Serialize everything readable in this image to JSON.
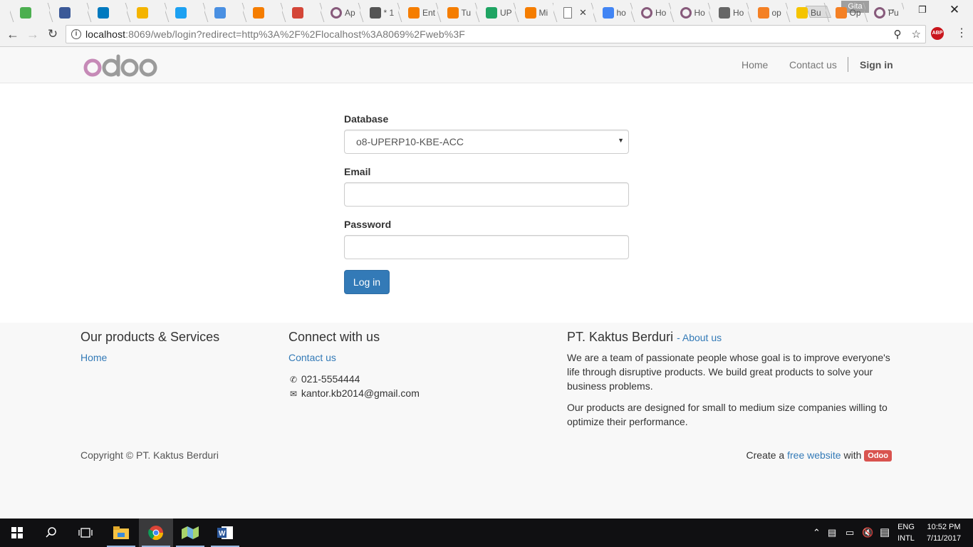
{
  "browser": {
    "tabs": [
      {
        "label": "",
        "color": "#4caf50"
      },
      {
        "label": "",
        "color": "#3b5998"
      },
      {
        "label": "",
        "color": "#0079bf"
      },
      {
        "label": "",
        "color": "#f4b400"
      },
      {
        "label": "",
        "color": "#1da1f2"
      },
      {
        "label": "",
        "color": "#4a90e2"
      },
      {
        "label": "",
        "color": "#f57d00"
      },
      {
        "label": "",
        "color": "#d44638"
      },
      {
        "label": "Ap",
        "color": "ring"
      },
      {
        "label": "* 1",
        "color": "#555555"
      },
      {
        "label": "Ent",
        "color": "#f57d00"
      },
      {
        "label": "Tu",
        "color": "#f57d00"
      },
      {
        "label": "UP",
        "color": "#1fa463"
      },
      {
        "label": "Mi",
        "color": "#f57d00"
      },
      {
        "label": "",
        "color": "#ffffff",
        "active": true
      },
      {
        "label": "ho",
        "color": "#4285f4"
      },
      {
        "label": "Ho",
        "color": "ring"
      },
      {
        "label": "Ho",
        "color": "ring"
      },
      {
        "label": "Ho",
        "color": "#666666"
      },
      {
        "label": "op",
        "color": "#f48024"
      },
      {
        "label": "Bu",
        "color": "#f5c400"
      },
      {
        "label": "Op",
        "color": "#f48024"
      },
      {
        "label": "Pu",
        "color": "ring"
      }
    ],
    "profile_name": "Gita",
    "url_host": "localhost",
    "url_rest": ":8069/web/login?redirect=http%3A%2F%2Flocalhost%3A8069%2Fweb%3F",
    "abp_label": "ABP"
  },
  "header": {
    "logo_text": "odoo",
    "nav": {
      "home": "Home",
      "contact": "Contact us",
      "signin": "Sign in"
    }
  },
  "login": {
    "database_label": "Database",
    "database_value": "o8-UPERP10-KBE-ACC",
    "email_label": "Email",
    "email_value": "",
    "password_label": "Password",
    "password_value": "",
    "submit_label": "Log in"
  },
  "footer": {
    "products_heading": "Our products & Services",
    "products_link": "Home",
    "connect_heading": "Connect with us",
    "connect_link": "Contact us",
    "phone": "021-5554444",
    "email": "kantor.kb2014@gmail.com",
    "company_heading": "PT. Kaktus Berduri",
    "about_link": "- About us",
    "about_p1": "We are a team of passionate people whose goal is to improve everyone's life through disruptive products. We build great products to solve your business problems.",
    "about_p2": "Our products are designed for small to medium size companies willing to optimize their performance.",
    "copyright": "Copyright © PT. Kaktus Berduri",
    "create_prefix": "Create a",
    "create_link": "free website",
    "create_with": "with",
    "badge": "Odoo"
  },
  "taskbar": {
    "lang_top": "ENG",
    "lang_bottom": "INTL",
    "time": "10:52 PM",
    "date": "7/11/2017"
  }
}
